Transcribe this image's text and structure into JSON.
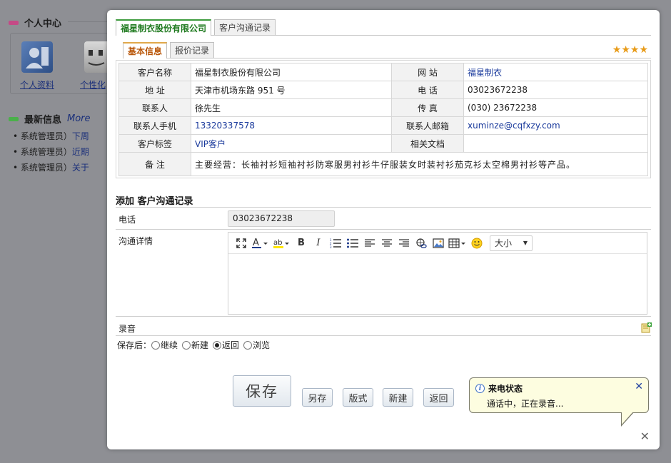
{
  "background": {
    "personal_center": "个人中心",
    "apps": [
      {
        "label": "个人资料",
        "icon": "user-profile-icon"
      },
      {
        "label": "个性化",
        "icon": "finder-icon"
      }
    ],
    "latest_info": "最新信息",
    "more": "More",
    "news": [
      {
        "prefix": "系统管理员）",
        "link": "下周"
      },
      {
        "prefix": "系统管理员）",
        "link": "近期"
      },
      {
        "prefix": "系统管理员）",
        "link": "关于"
      }
    ]
  },
  "dialog": {
    "top_tabs": [
      "福星制衣股份有限公司",
      "客户沟通记录"
    ],
    "sub_tabs": [
      "基本信息",
      "报价记录"
    ],
    "rating_stars": "★★★★",
    "info": {
      "rows": [
        {
          "k1": "客户名称",
          "v1": "福星制衣股份有限公司",
          "k2": "网 站",
          "v2": "福星制衣"
        },
        {
          "k1": "地 址",
          "v1": "天津市机场东路 951 号",
          "k2": "电 话",
          "v2": "03023672238"
        },
        {
          "k1": "联系人",
          "v1": "徐先生",
          "k2": "传 真",
          "v2": "(030) 23672238"
        },
        {
          "k1": "联系人手机",
          "v1": "13320337578",
          "k2": "联系人邮箱",
          "v2": "xuminze@cqfxzy.com"
        },
        {
          "k1": "客户标签",
          "v1": "VIP客户",
          "k2": "相关文档",
          "v2": ""
        }
      ],
      "note_label": "备 注",
      "note": "主要经营：长袖衬衫短袖衬衫防寒服男衬衫牛仔服装女时装衬衫茄克衫太空棉男衬衫等产品。"
    },
    "form": {
      "section_title": "添加 客户沟通记录",
      "phone_label": "电话",
      "phone_value": "03023672238",
      "detail_label": "沟通详情",
      "font_size_label": "大小",
      "recording_label": "录音",
      "save_after_label": "保存后：",
      "options": [
        "继续",
        "新建",
        "返回",
        "浏览"
      ],
      "selected_option": "返回"
    },
    "buttons": {
      "save": "保存",
      "save_as": "另存",
      "format": "版式",
      "new": "新建",
      "back": "返回"
    },
    "call_status": {
      "title": "来电状态",
      "message": "通话中，正在录音..."
    }
  }
}
